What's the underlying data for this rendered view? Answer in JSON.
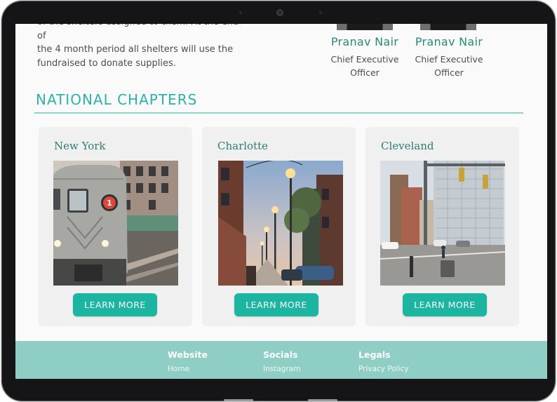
{
  "intro": {
    "lines": [
      "of the shelters assigned to them. At the end of",
      "the 4 month period all shelters will use the",
      "fundraised to donate supplies."
    ]
  },
  "team": [
    {
      "name": "Pranav Nair",
      "title_line1": "Chief Executive",
      "title_line2": "Officer"
    },
    {
      "name": "Pranav Nair",
      "title_line1": "Chief Executive",
      "title_line2": "Officer"
    }
  ],
  "chapters": {
    "heading": "NATIONAL CHAPTERS",
    "items": [
      {
        "city": "New York",
        "button": "LEARN MORE",
        "photo": "subway-train-photo"
      },
      {
        "city": "Charlotte",
        "button": "LEARN MORE",
        "photo": "street-lamps-photo"
      },
      {
        "city": "Cleveland",
        "button": "LEARN MORE",
        "photo": "city-intersection-photo"
      }
    ]
  },
  "footer": {
    "columns": [
      {
        "heading": "Website",
        "link": "Home"
      },
      {
        "heading": "Socials",
        "link": "Instagram"
      },
      {
        "heading": "Legals",
        "link": "Privacy Policy"
      }
    ]
  },
  "colors": {
    "accent": "#2bb3a5",
    "button": "#1cb5a1",
    "footer": "#8fcec4",
    "name": "#2a8a7a"
  }
}
